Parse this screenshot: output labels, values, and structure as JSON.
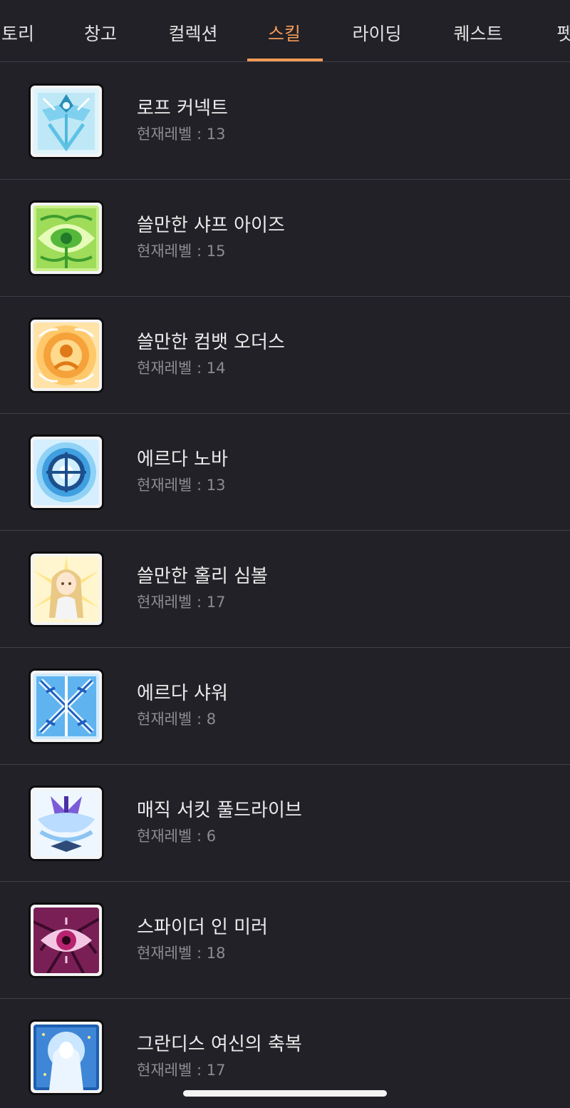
{
  "tabs": [
    {
      "label": "토리"
    },
    {
      "label": "창고"
    },
    {
      "label": "컬렉션"
    },
    {
      "label": "스킬"
    },
    {
      "label": "라이딩"
    },
    {
      "label": "퀘스트"
    },
    {
      "label": "펫"
    }
  ],
  "active_tab": "스킬",
  "colors": {
    "accent": "#f59a57",
    "background": "#212127",
    "divider": "#3e3e46",
    "secondary_text": "#8c8c93"
  },
  "level_prefix": "현재레벨 : ",
  "skills": [
    {
      "name": "로프 커넥트",
      "level_text": "현재레벨 : 13",
      "icon": "rope-connect-icon"
    },
    {
      "name": "쓸만한 샤프 아이즈",
      "level_text": "현재레벨 : 15",
      "icon": "sharp-eyes-icon"
    },
    {
      "name": "쓸만한 컴뱃 오더스",
      "level_text": "현재레벨 : 14",
      "icon": "combat-orders-icon"
    },
    {
      "name": "에르다 노바",
      "level_text": "현재레벨 : 13",
      "icon": "erda-nova-icon"
    },
    {
      "name": "쓸만한 홀리 심볼",
      "level_text": "현재레벨 : 17",
      "icon": "holy-symbol-icon"
    },
    {
      "name": "에르다 샤워",
      "level_text": "현재레벨 : 8",
      "icon": "erda-shower-icon"
    },
    {
      "name": "매직 서킷 풀드라이브",
      "level_text": "현재레벨 : 6",
      "icon": "magic-circuit-icon"
    },
    {
      "name": "스파이더 인 미러",
      "level_text": "현재레벨 : 18",
      "icon": "spider-in-mirror-icon"
    },
    {
      "name": "그란디스 여신의 축복",
      "level_text": "현재레벨 : 17",
      "icon": "grandis-blessing-icon"
    }
  ]
}
